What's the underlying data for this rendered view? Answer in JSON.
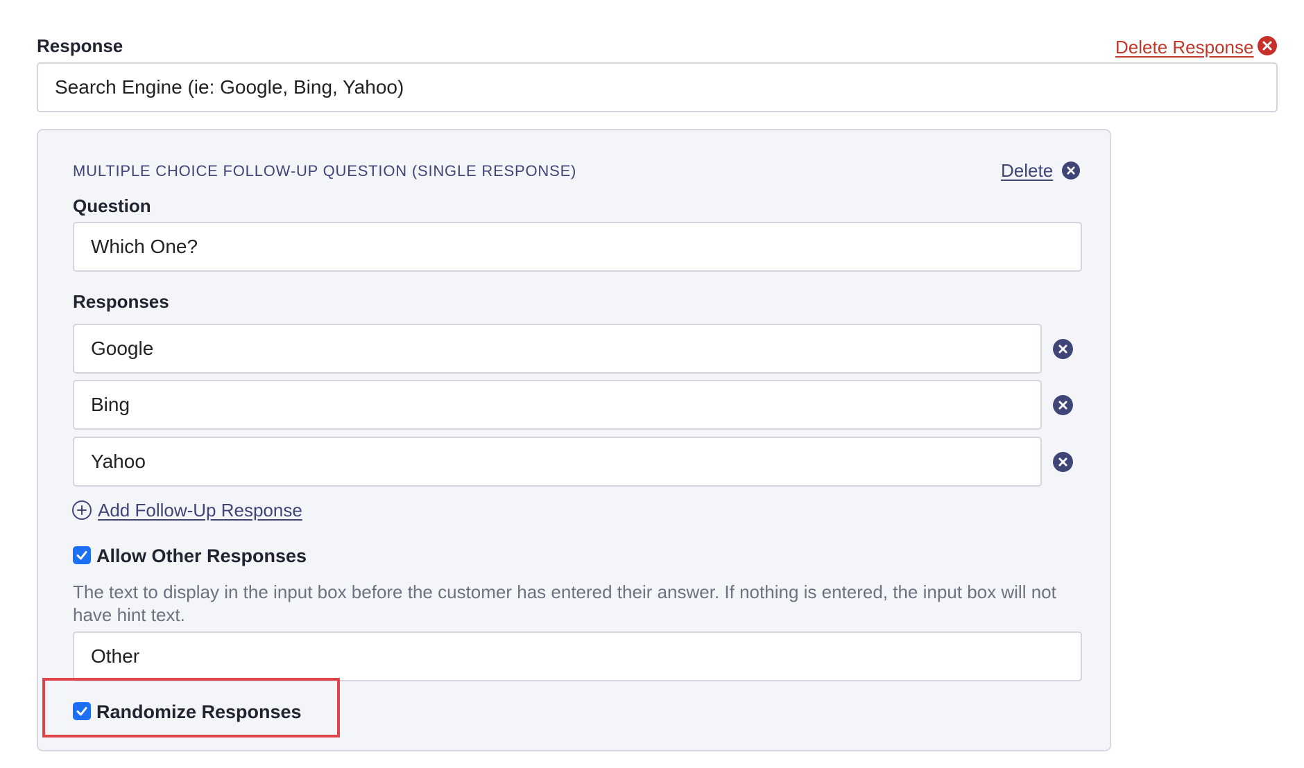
{
  "response": {
    "label": "Response",
    "delete_label": "Delete Response",
    "value": "Search Engine (ie: Google, Bing, Yahoo)"
  },
  "followup": {
    "section_title": "MULTIPLE CHOICE FOLLOW-UP QUESTION (SINGLE RESPONSE)",
    "delete_label": "Delete",
    "question_label": "Question",
    "question_value": "Which One?",
    "responses_label": "Responses",
    "responses": [
      {
        "value": "Google"
      },
      {
        "value": "Bing"
      },
      {
        "value": "Yahoo"
      }
    ],
    "add_response_label": "Add Follow-Up Response",
    "allow_other": {
      "checked": true,
      "label": "Allow Other Responses"
    },
    "hint_help": "The text to display in the input box before the customer has entered their answer. If nothing is entered, the input box will not have hint text.",
    "other_value": "Other",
    "randomize": {
      "checked": true,
      "label": "Randomize Responses"
    }
  },
  "icons": {
    "delete_response": "close-circle-icon",
    "delete_followup": "close-circle-icon",
    "remove_response": "close-circle-icon",
    "add_response": "plus-circle-icon",
    "checkbox": "check-icon"
  },
  "colors": {
    "danger": "#c0392b",
    "navy": "#3f4577",
    "checkbox": "#1a6ff2",
    "highlight": "#e0444b",
    "panel_bg": "#f4f5f9"
  }
}
